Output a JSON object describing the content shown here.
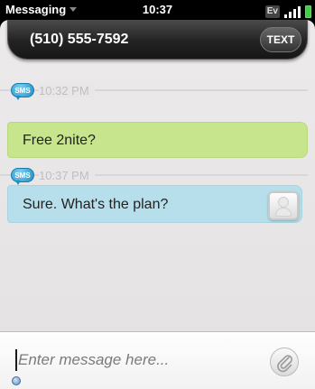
{
  "status_bar": {
    "app_name": "Messaging",
    "time": "10:37",
    "network": "Ev"
  },
  "conversation": {
    "contact": "(510) 555-7592",
    "send_mode_label": "TEXT"
  },
  "messages": [
    {
      "badge": "SMS",
      "timestamp": "10:32 PM",
      "text": "Free 2nite?",
      "direction": "outgoing",
      "bubble_color": "#c6e58c"
    },
    {
      "badge": "SMS",
      "timestamp": "10:37 PM",
      "text": "Sure. What's the plan?",
      "direction": "incoming",
      "bubble_color": "#b6dfeb"
    }
  ],
  "compose": {
    "placeholder": "Enter message here..."
  },
  "icons": {
    "attach": "paperclip-icon",
    "avatar": "contact-avatar-icon",
    "signal": "signal-bars-icon",
    "battery": "battery-icon"
  }
}
